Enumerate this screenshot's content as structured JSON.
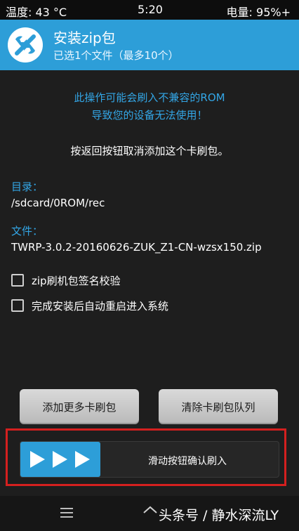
{
  "status_bar": {
    "temperature": "温度: 43 °C",
    "time": "5:20",
    "battery": "电量: 95%+"
  },
  "header": {
    "title": "安装zip包",
    "subtitle": "已选1个文件（最多10个）",
    "logo_icon": "twrp-logo-icon"
  },
  "warning": {
    "line1": "此操作可能会刷入不兼容的ROM",
    "line2": "导致您的设备无法使用！"
  },
  "instruction": "按返回按钮取消添加这个卡刷包。",
  "directory": {
    "label": "目录：",
    "value": "/sdcard/0ROM/rec"
  },
  "file": {
    "label": "文件：",
    "value": "TWRP-3.0.2-20160626-ZUK_Z1-CN-wzsx150.zip"
  },
  "options": [
    {
      "label": "zip刷机包签名校验",
      "checked": false
    },
    {
      "label": "完成安装后自动重启进入系统",
      "checked": false
    }
  ],
  "buttons": {
    "add_more": "添加更多卡刷包",
    "clear_queue": "清除卡刷包队列"
  },
  "slider": {
    "label": "滑动按钮确认刷入",
    "icon": "triple-play-arrow-icon",
    "position": 0
  },
  "nav": {
    "menu_icon": "menu-icon",
    "home_icon": "home-icon"
  },
  "watermark": "头条号 / 静水深流LY",
  "colors": {
    "accent": "#2d9ed8",
    "warning_text": "#33a6e6",
    "background": "#1e1e1e",
    "highlight": "#d4201f"
  }
}
